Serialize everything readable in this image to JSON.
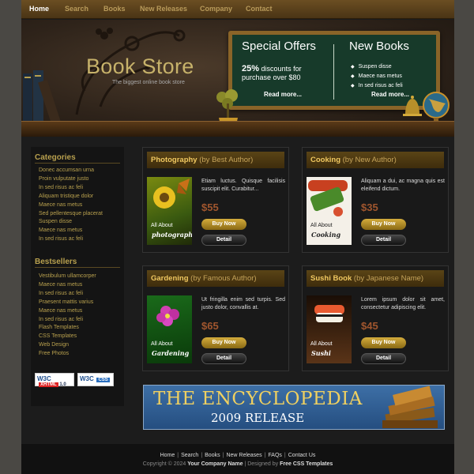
{
  "nav": [
    {
      "label": "Home",
      "active": true
    },
    {
      "label": "Search"
    },
    {
      "label": "Books"
    },
    {
      "label": "New Releases"
    },
    {
      "label": "Company"
    },
    {
      "label": "Contact"
    }
  ],
  "header": {
    "title": "Book Store",
    "tagline": "The biggest online book store"
  },
  "board": {
    "offers_title": "Special Offers",
    "offers_highlight": "25%",
    "offers_text": "discounts for purchase over $80",
    "offers_more": "Read more...",
    "new_title": "New Books",
    "new_items": [
      "Suspen disse",
      "Maece nas metus",
      "In sed risus ac feli"
    ],
    "new_more": "Read more..."
  },
  "sidebar": {
    "categories_title": "Categories",
    "categories": [
      "Donec accumsan urna",
      "Proin vulputate justo",
      "In sed risus ac feli",
      "Aliquam tristique dolor",
      "Maece nas metus",
      "Sed pellentesque placerat",
      "Suspen disse",
      "Maece nas metus",
      "In sed risus ac feli"
    ],
    "bestsellers_title": "Bestsellers",
    "bestsellers": [
      "Vestibulum ullamcorper",
      "Maece nas metus",
      "In sed risus ac feli",
      "Praesent mattis varius",
      "Maece nas metus",
      "In sed risus ac feli",
      "Flash Templates",
      "CSS Templates",
      "Web Design",
      "Free Photos"
    ],
    "badge_xhtml": {
      "w3c": "W3C",
      "label": "XHTML",
      "version": "1.0"
    },
    "badge_css": {
      "w3c": "W3C",
      "label": "CSS"
    }
  },
  "books": [
    {
      "title": "Photography",
      "by": "(by Best Author)",
      "about": "All About",
      "topic": "photography",
      "desc": "Etiam luctus. Quisque facilisis suscipit elit. Curabitur...",
      "price": "$55",
      "buy": "Buy Now",
      "detail": "Detail"
    },
    {
      "title": "Cooking",
      "by": "(by New Author)",
      "about": "All About",
      "topic": "Cooking",
      "desc": "Aliquam a dui, ac magna quis est eleifend dictum.",
      "price": "$35",
      "buy": "Buy Now",
      "detail": "Detail"
    },
    {
      "title": "Gardening",
      "by": "(by Famous Author)",
      "about": "All About",
      "topic": "Gardening",
      "desc": "Ut fringilla enim sed turpis. Sed justo dolor, convallis at.",
      "price": "$65",
      "buy": "Buy Now",
      "detail": "Detail"
    },
    {
      "title": "Sushi Book",
      "by": "(by Japanese Name)",
      "about": "All About",
      "topic": "Sushi",
      "desc": "Lorem ipsum dolor sit amet, consectetur adipiscing elit.",
      "price": "$45",
      "buy": "Buy Now",
      "detail": "Detail"
    }
  ],
  "banner": {
    "line1": "THE ENCYCLOPEDIA",
    "line2": "2009 RELEASE"
  },
  "footer": {
    "links": [
      "Home",
      "Search",
      "Books",
      "New Releases",
      "FAQs",
      "Contact Us"
    ],
    "copyright_prefix": "Copyright © 2024",
    "company": "Your Company Name",
    "designed_prefix": "| Designed by",
    "designer": "Free CSS Templates"
  }
}
